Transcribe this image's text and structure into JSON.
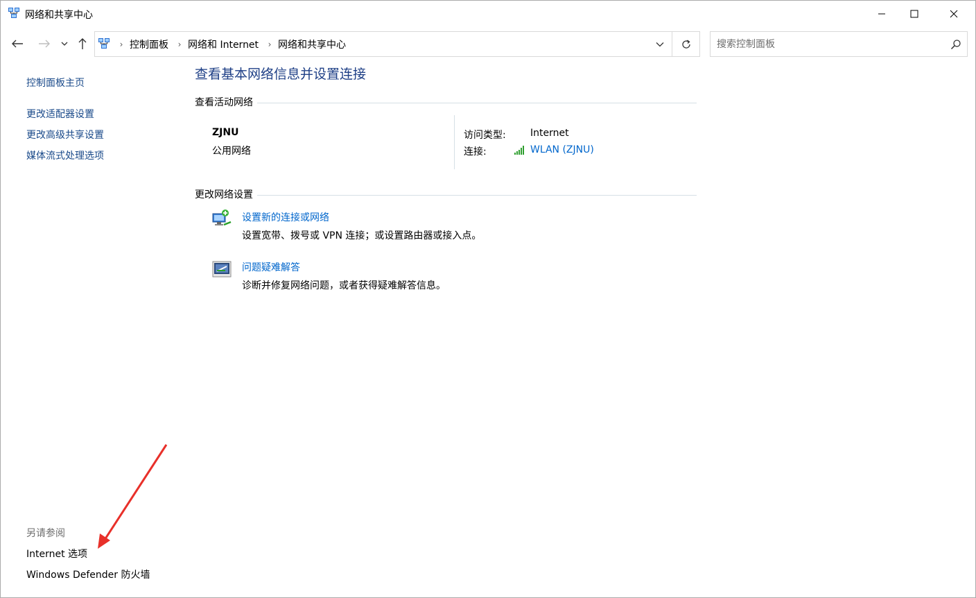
{
  "window": {
    "title": "网络和共享中心",
    "minimize_glyph": "—",
    "maximize_glyph": "□",
    "close_glyph": "✕"
  },
  "address": {
    "breadcrumbs": [
      "控制面板",
      "网络和 Internet",
      "网络和共享中心"
    ],
    "search_placeholder": "搜索控制面板"
  },
  "sidebar": {
    "home": "控制面板主页",
    "links": [
      "更改适配器设置",
      "更改高级共享设置",
      "媒体流式处理选项"
    ],
    "see_also_title": "另请参阅",
    "see_also": [
      "Internet 选项",
      "Windows Defender 防火墙"
    ]
  },
  "main": {
    "title": "查看基本网络信息并设置连接",
    "active_section": "查看活动网络",
    "network": {
      "name": "ZJNU",
      "category": "公用网络",
      "access_label": "访问类型:",
      "access_value": "Internet",
      "connection_label": "连接:",
      "connection_value": "WLAN (ZJNU)"
    },
    "change_section": "更改网络设置",
    "tasks": [
      {
        "label": "设置新的连接或网络",
        "desc": "设置宽带、拨号或 VPN 连接；或设置路由器或接入点。",
        "icon": "new-connection-icon"
      },
      {
        "label": "问题疑难解答",
        "desc": "诊断并修复网络问题，或者获得疑难解答信息。",
        "icon": "troubleshoot-icon"
      }
    ]
  },
  "colors": {
    "link_blue": "#0066cc",
    "title_blue": "#1e3f86",
    "annotation_red": "#e8302a"
  }
}
